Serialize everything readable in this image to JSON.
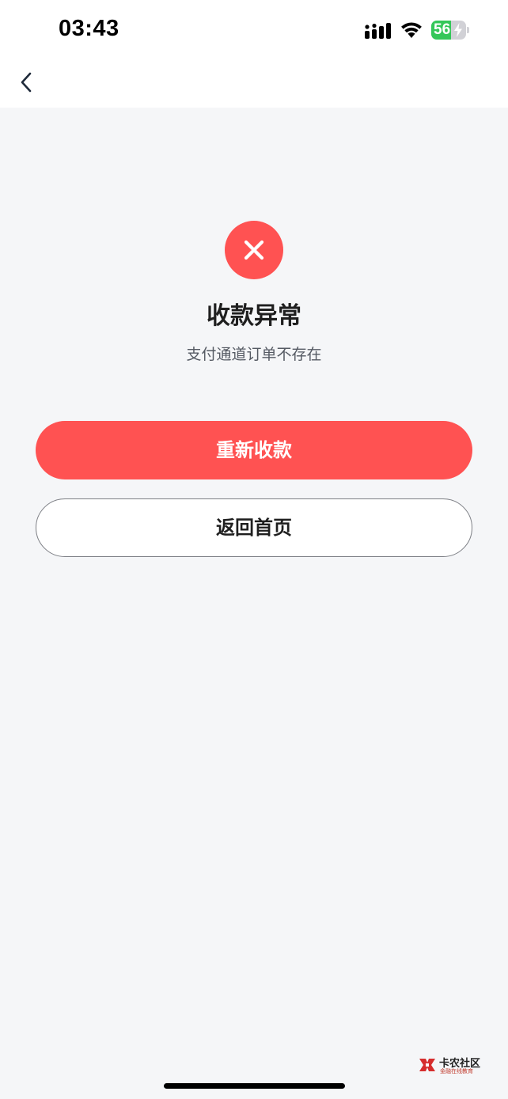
{
  "status_bar": {
    "time": "03:43",
    "battery_level": "56",
    "battery_fraction": 0.56,
    "signal_icon": "cellular-signal-icon",
    "wifi_icon": "wifi-icon",
    "charging_icon": "charging-bolt-icon"
  },
  "nav": {
    "back_icon": "chevron-left-icon"
  },
  "result": {
    "status_icon": "close-icon",
    "title": "收款异常",
    "message": "支付通道订单不存在"
  },
  "actions": {
    "retry_label": "重新收款",
    "home_label": "返回首页"
  },
  "watermark": {
    "title": "卡农社区",
    "subtitle": "金融在线教育"
  },
  "colors": {
    "accent": "#ff5252",
    "background": "#f5f6f8",
    "battery_green": "#34c759"
  }
}
